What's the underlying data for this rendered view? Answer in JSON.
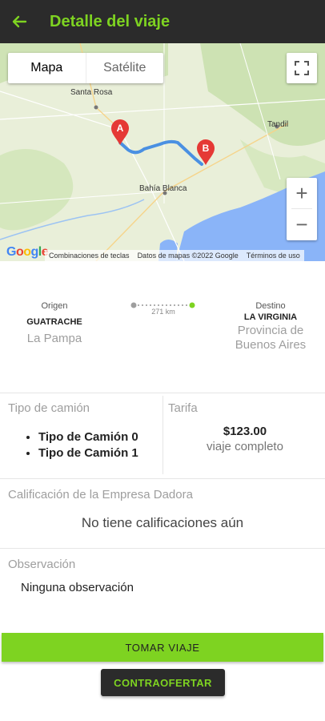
{
  "appbar": {
    "title": "Detalle del viaje"
  },
  "map": {
    "type_toggle": {
      "map_label": "Mapa",
      "satellite_label": "Satélite"
    },
    "cities": [
      "Santa Rosa",
      "Tandil",
      "Bahía Blanca"
    ],
    "markers": [
      "A",
      "B"
    ],
    "zoom_in": "+",
    "zoom_out": "−",
    "logo": "Google",
    "attribution": [
      "Combinaciones de teclas",
      "Datos de mapas ©2022 Google",
      "Términos de uso"
    ]
  },
  "route": {
    "origin_label": "Origen",
    "origin_city": "GUATRACHE",
    "origin_province": "La Pampa",
    "distance": "271 km",
    "destination_label": "Destino",
    "destination_city": "LA VIRGINIA",
    "destination_province": "Provincia de Buenos Aires"
  },
  "truck": {
    "label": "Tipo de camión",
    "types": [
      "Tipo de Camión 0",
      "Tipo de Camión 1"
    ]
  },
  "rate": {
    "label": "Tarifa",
    "price": "$123.00",
    "unit": "viaje completo"
  },
  "rating": {
    "label": "Calificación de la Empresa Dadora",
    "text": "No tiene calificaciones aún"
  },
  "observation": {
    "label": "Observación",
    "text": "Ninguna observación"
  },
  "actions": {
    "take_trip": "TOMAR VIAJE",
    "counteroffer": "CONTRAOFERTAR"
  },
  "colors": {
    "accent": "#7ed321",
    "appbar": "#2b2b2b",
    "route": "#4a90e2",
    "marker": "#e53935"
  }
}
